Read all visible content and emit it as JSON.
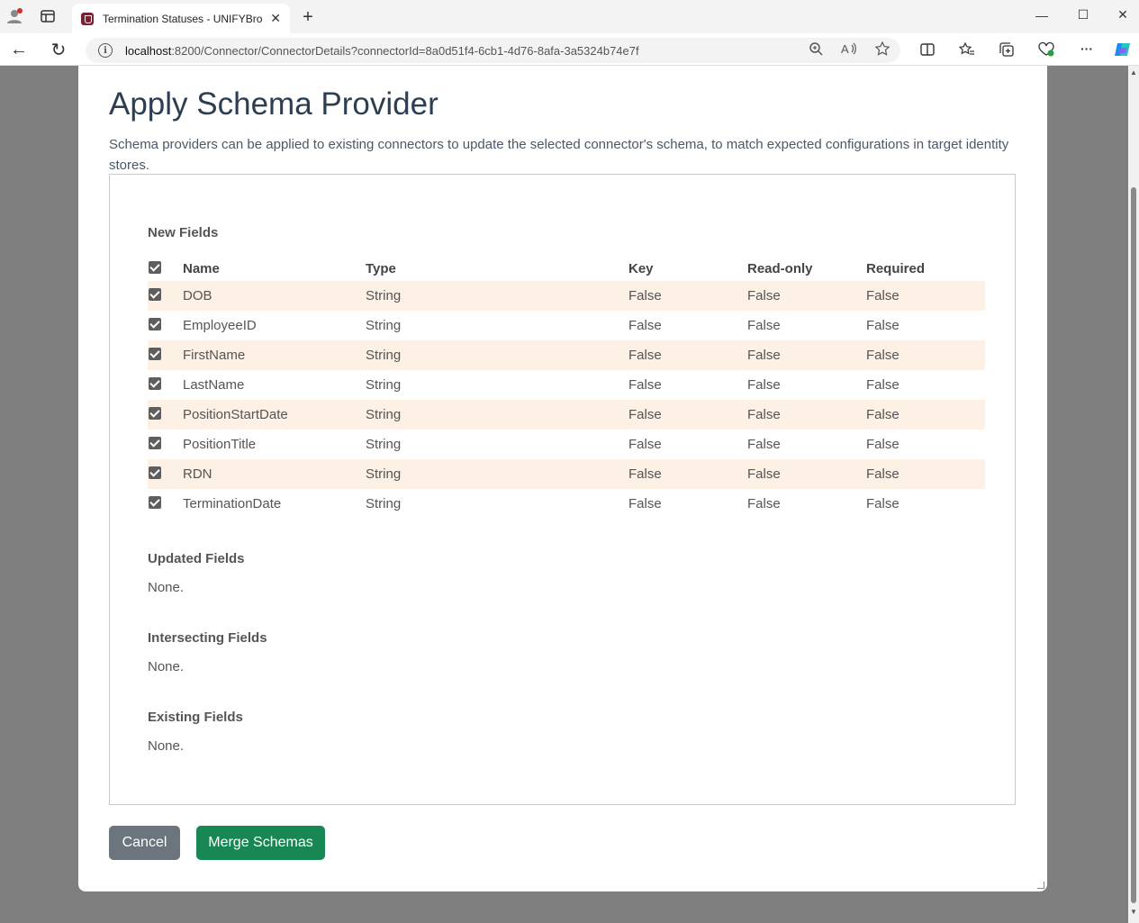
{
  "browser": {
    "tab_title": "Termination Statuses - UNIFYBrok",
    "url_host": "localhost",
    "url_rest": ":8200/Connector/ConnectorDetails?connectorId=8a0d51f4-6cb1-4d76-8afa-3a5324b74e7f",
    "new_tab_glyph": "+",
    "tab_close_glyph": "✕",
    "minimize_glyph": "—",
    "maximize_glyph": "☐",
    "close_glyph": "✕",
    "back_glyph": "←",
    "refresh_glyph": "↻",
    "info_glyph": "i",
    "more_glyph": "···"
  },
  "modal": {
    "title": "Apply Schema Provider",
    "description": "Schema providers can be applied to existing connectors to update the selected connector's schema, to match expected configurations in target identity stores.",
    "new_fields": {
      "label": "New Fields",
      "columns": [
        "Name",
        "Type",
        "Key",
        "Read-only",
        "Required"
      ],
      "rows": [
        {
          "name": "DOB",
          "type": "String",
          "key": "False",
          "readonly": "False",
          "required": "False"
        },
        {
          "name": "EmployeeID",
          "type": "String",
          "key": "False",
          "readonly": "False",
          "required": "False"
        },
        {
          "name": "FirstName",
          "type": "String",
          "key": "False",
          "readonly": "False",
          "required": "False"
        },
        {
          "name": "LastName",
          "type": "String",
          "key": "False",
          "readonly": "False",
          "required": "False"
        },
        {
          "name": "PositionStartDate",
          "type": "String",
          "key": "False",
          "readonly": "False",
          "required": "False"
        },
        {
          "name": "PositionTitle",
          "type": "String",
          "key": "False",
          "readonly": "False",
          "required": "False"
        },
        {
          "name": "RDN",
          "type": "String",
          "key": "False",
          "readonly": "False",
          "required": "False"
        },
        {
          "name": "TerminationDate",
          "type": "String",
          "key": "False",
          "readonly": "False",
          "required": "False"
        }
      ]
    },
    "updated_fields": {
      "label": "Updated Fields",
      "value": "None."
    },
    "intersecting_fields": {
      "label": "Intersecting Fields",
      "value": "None."
    },
    "existing_fields": {
      "label": "Existing Fields",
      "value": "None."
    },
    "cancel_label": "Cancel",
    "merge_label": "Merge Schemas"
  },
  "colors": {
    "merge_button": "#198754",
    "cancel_button": "#6c757d",
    "row_highlight": "#fdf0e4"
  }
}
